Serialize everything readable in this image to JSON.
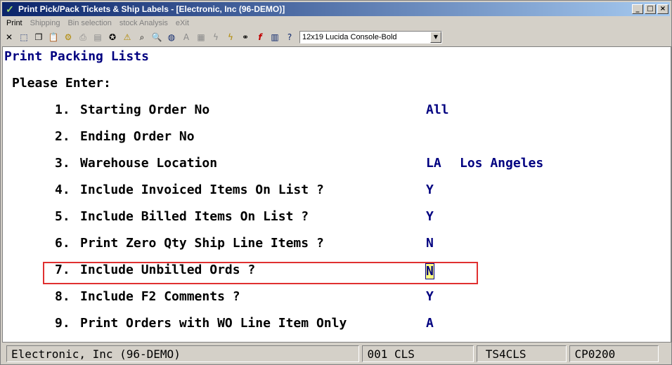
{
  "window": {
    "title": "Print Pick/Pack Tickets & Ship Labels - [Electronic, Inc (96-DEMO)]"
  },
  "menu": [
    {
      "label": "Print",
      "enabled": true
    },
    {
      "label": "Shipping",
      "enabled": false
    },
    {
      "label": "Bin selection",
      "enabled": false
    },
    {
      "label": "stock Analysis",
      "enabled": false
    },
    {
      "label": "eXit",
      "enabled": false
    }
  ],
  "toolbar": {
    "icons": [
      "close-icon",
      "select-icon",
      "copy-icon",
      "paste-icon",
      "settings-icon",
      "print-icon",
      "notes-icon",
      "lookup-icon",
      "warning-icon",
      "find-icon",
      "globe-icon",
      "font-icon",
      "calculator-icon",
      "lightning-icon",
      "reports-icon",
      "link-icon",
      "function-icon",
      "calendar-icon",
      "help-icon"
    ],
    "font_select": "12x19 Lucida Console-Bold"
  },
  "screen": {
    "title": "Print Packing Lists",
    "prompt": "Please Enter:",
    "fields": [
      {
        "num": "1.",
        "label": "Starting Order No",
        "value": "All",
        "extra": ""
      },
      {
        "num": "2.",
        "label": "Ending Order No",
        "value": "",
        "extra": ""
      },
      {
        "num": "3.",
        "label": "Warehouse Location",
        "value": "LA",
        "extra": "Los Angeles"
      },
      {
        "num": "4.",
        "label": "Include Invoiced Items On List ?",
        "value": "Y",
        "extra": ""
      },
      {
        "num": "5.",
        "label": "Include Billed Items On List ?",
        "value": "Y",
        "extra": ""
      },
      {
        "num": "6.",
        "label": "Print Zero Qty Ship Line Items ?",
        "value": "N",
        "extra": ""
      },
      {
        "num": "7.",
        "label": "Include Unbilled Ords ?",
        "value": "N",
        "extra": ""
      },
      {
        "num": "8.",
        "label": "Include F2 Comments ?",
        "value": "Y",
        "extra": ""
      },
      {
        "num": "9.",
        "label": "Print Orders with WO Line Item Only",
        "value": "A",
        "extra": ""
      }
    ]
  },
  "status": {
    "company": "Electronic, Inc (96-DEMO)",
    "terminal": "001 CLS",
    "user": "TS4CLS",
    "program": "CP0200"
  }
}
